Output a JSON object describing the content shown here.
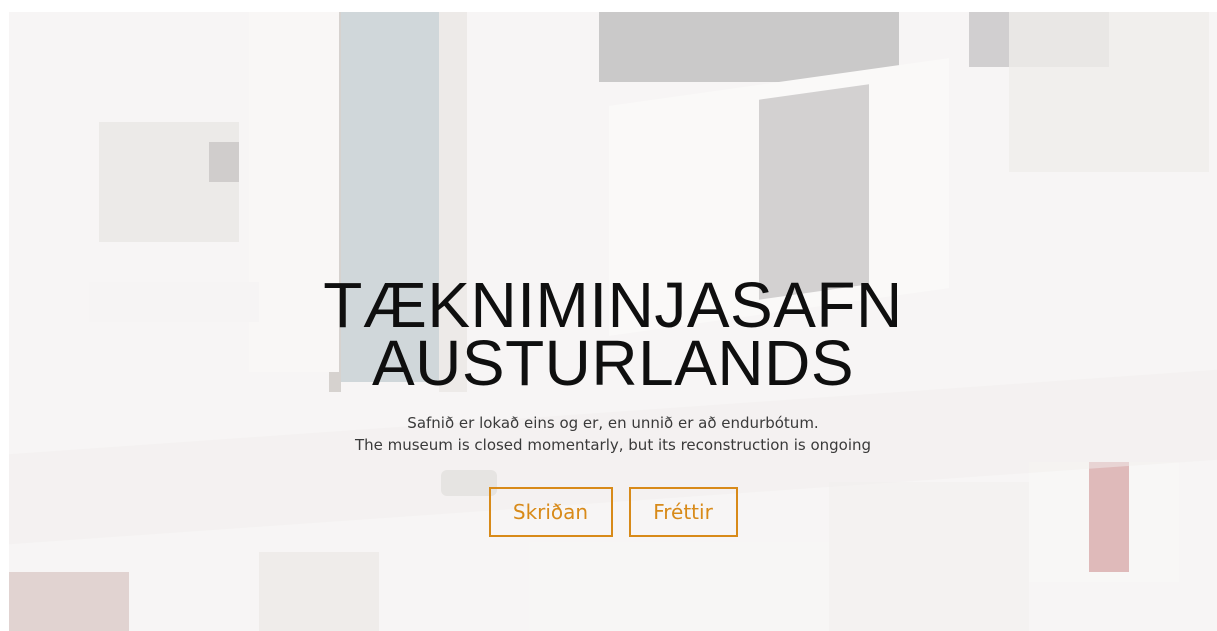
{
  "hero": {
    "title_line1": "TÆKNIMINJASAFN",
    "title_line2": "AUSTURLANDS",
    "subtitle_is": "Safnið er lokað eins og er, en unnið er að endurbótum.",
    "subtitle_en": "The museum is closed momentarly, but its reconstruction is ongoing"
  },
  "buttons": {
    "skridan": "Skriðan",
    "frettir": "Fréttir"
  },
  "colors": {
    "accent": "#d88a19",
    "title": "#0f0f0f",
    "subtitle": "#3a3a3a"
  }
}
